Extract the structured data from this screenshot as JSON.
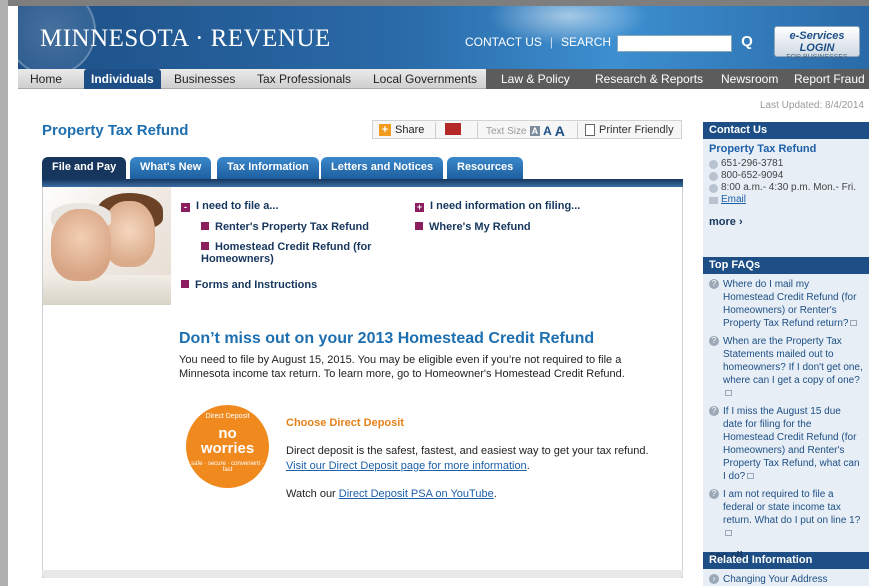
{
  "header": {
    "logo": "MINNESOTA · REVENUE",
    "contact_us": "CONTACT US",
    "separator": "|",
    "search_label": "SEARCH",
    "search_placeholder": "",
    "search_go": "Q",
    "eservices_label": "e-Services LOGIN",
    "eservices_sub": "FOR BUSINESSES"
  },
  "nav": {
    "items": [
      "Home",
      "Individuals",
      "Businesses",
      "Tax Professionals",
      "Local Governments",
      "Law & Policy",
      "Research & Reports",
      "Newsroom",
      "Report Fraud"
    ]
  },
  "last_updated": "Last Updated: 8/4/2014",
  "page_title": "Property Tax Refund",
  "toolbar": {
    "share": "Share",
    "share_icon": "+",
    "text_size": "Text Size",
    "size_a": "A",
    "printer": "Printer Friendly"
  },
  "tabs": [
    "File and Pay",
    "What's New",
    "Tax Information",
    "Letters and Notices",
    "Resources"
  ],
  "content": {
    "need_to_file": "I need to file a...",
    "need_to_file_icon": "-",
    "renters_refund": "Renter's Property Tax Refund",
    "homestead_refund": "Homestead Credit Refund (for Homeowners)",
    "forms": "Forms and Instructions",
    "need_info": "I need information on filing...",
    "need_info_icon": "+",
    "wheres_refund": "Where's My Refund",
    "headline": "Don’t miss out on your 2013 Homestead Credit Refund",
    "paragraph": "You need to file by August 15, 2015. You may be eligible even if you’re not required to file a Minnesota income tax return. To learn more, go to Homeowner's Homestead Credit Refund.",
    "badge_top": "Direct Deposit",
    "badge_no": "no",
    "badge_worries": "worries",
    "badge_bottom": "safe · secure · convenient · fast",
    "dd_title": "Choose Direct Deposit",
    "dd_text": "Direct deposit is the safest, fastest, and easiest way to get your tax refund.",
    "dd_link": "Visit our Direct Deposit page for more information",
    "dd_watch": "Watch our",
    "dd_watch_link": "Direct Deposit PSA on YouTube",
    "period": "."
  },
  "contact": {
    "header": "Contact Us",
    "title": "Property Tax Refund",
    "phone1": "651-296-3781",
    "phone2": "800-652-9094",
    "hours": "8:00 a.m.- 4:30 p.m. Mon.- Fri.",
    "email": "Email",
    "more": "more ›"
  },
  "faqs": {
    "header": "Top FAQs",
    "items": [
      "Where do I mail my Homestead Credit Refund (for Homeowners) or Renter's Property Tax Refund return?",
      "When are the Property Tax Statements mailed out to homeowners? If I don't get one, where can I get a copy of one?",
      "If I miss the August 15 due date for filing for the Homestead Credit Refund (for Homeowners) and Renter's Property Tax Refund, what can I do?",
      "I am not required to file a federal or state income tax return. What do I put on line 1?"
    ],
    "see_all": "see all ›"
  },
  "related": {
    "header": "Related Information",
    "items": [
      "Changing Your Address"
    ]
  },
  "colors": {
    "brand_blue": "#1d4f86",
    "link_blue": "#1d6fb0",
    "accent_orange": "#f08a1f",
    "bullet_maroon": "#8c1d5f"
  }
}
